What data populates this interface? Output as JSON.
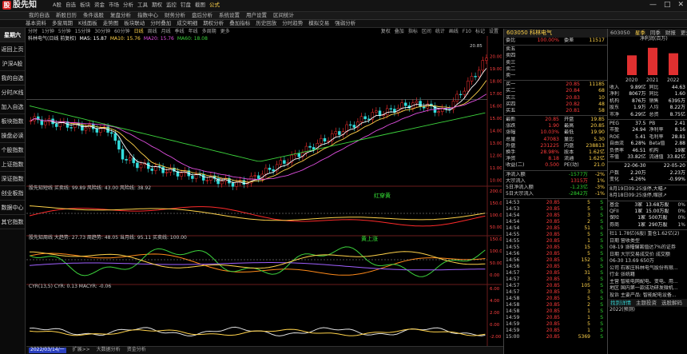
{
  "app": {
    "title": "股先知",
    "menu": [
      "A股",
      "自选",
      "板块",
      "资金",
      "市场",
      "分析",
      "工具",
      "期权",
      "监控",
      "钉盘",
      "截图"
    ],
    "menu_hl": "公式",
    "window_controls": [
      "—",
      "□",
      "✕"
    ]
  },
  "menu2": [
    "我的自选",
    "新股日历",
    "条件选股",
    "复盘分析",
    "指数中心",
    "财务分析",
    "盘后分析",
    "系统设置",
    "用户设置",
    "区间统计"
  ],
  "menu3": [
    "基本资料",
    "多窗周期",
    "K线面板",
    "走势图",
    "板块联动",
    "分时叠加",
    "成交明细",
    "期权分析",
    "叠加指标",
    "历史回放",
    "分时趋势",
    "模拟交易",
    "强弱分析"
  ],
  "sidebar": [
    {
      "label": "星期六",
      "header": true
    },
    {
      "label": "返回上页"
    },
    {
      "label": "沪深A股"
    },
    {
      "label": "我的自选"
    },
    {
      "label": "分时/K线"
    },
    {
      "label": "加入自选"
    },
    {
      "label": "板块指数"
    },
    {
      "label": "操盘必读"
    },
    {
      "label": "个股指数"
    },
    {
      "label": "上证指数"
    },
    {
      "label": "深证指数"
    },
    {
      "label": "创业板指"
    },
    {
      "label": "数据中心"
    },
    {
      "label": "其它指数"
    }
  ],
  "toolbar": {
    "items": [
      "分时",
      "1分钟",
      "5分钟",
      "15分钟",
      "30分钟",
      "60分钟",
      "日线",
      "周线",
      "月线",
      "季线",
      "年线",
      "多周期",
      "更多"
    ],
    "active": "日线",
    "right": [
      "复权",
      "叠加",
      "指标",
      "区间",
      "统计",
      "画线",
      "F10",
      "标记",
      "设置"
    ]
  },
  "main_legend": {
    "name": "科林电气(日线 前复权)",
    "items": [
      {
        "text": "MA5: 15.87",
        "color": "#ffffff"
      },
      {
        "text": "MA10: 15.76",
        "color": "#ffd24a"
      },
      {
        "text": "MA20: 15.76",
        "color": "#e04fe0"
      },
      {
        "text": "MA60: 18.08",
        "color": "#3cd23c"
      }
    ]
  },
  "price_labels": {
    "high": "20.85",
    "low": "9.68",
    "current": "16.51"
  },
  "price_axis": [
    "20.00",
    "19.00",
    "18.00",
    "17.00",
    "16.00",
    "15.00",
    "14.00",
    "13.00",
    "12.00",
    "11.00",
    "10.00"
  ],
  "panels": [
    {
      "legend": "股先知短线  买卖线: 99.89  风险线: 43.00  风险线: 38.92",
      "annotation": "红穿黄",
      "axis": [
        "200.00",
        "150.00",
        "100.00",
        "50.00"
      ]
    },
    {
      "legend": "股先知周线  大趋势: 27.73  周趋势: 48.05  当月线: 95.11  买卖线: 100.00",
      "annotation": "黄上涨",
      "axis": [
        "150.00",
        "100.00",
        "50.00",
        "0.00"
      ]
    },
    {
      "legend": "CYR(13,5)  CYR: 0.13  MACYR: -0.06",
      "annotation": "",
      "axis": [
        "6.00",
        "4.00",
        "2.00",
        "0.00",
        "-2.00"
      ]
    }
  ],
  "date_label": "2022/03/14/一",
  "bottom_tabs": [
    "扩展>>",
    "大数据分析",
    "资金分析"
  ],
  "quote": {
    "code": "603050",
    "name": "科林电气",
    "webi": "委比",
    "webi_pct": "100.00%",
    "weicha": "委差",
    "weicha_val": "11517",
    "sell": [
      {
        "l": "卖五",
        "p": "",
        "v": ""
      },
      {
        "l": "卖四",
        "p": "",
        "v": ""
      },
      {
        "l": "卖三",
        "p": "",
        "v": ""
      },
      {
        "l": "卖二",
        "p": "",
        "v": ""
      },
      {
        "l": "卖一",
        "p": "",
        "v": ""
      }
    ],
    "buy": [
      {
        "l": "买一",
        "p": "20.85",
        "v": "11185"
      },
      {
        "l": "买二",
        "p": "20.84",
        "v": "68"
      },
      {
        "l": "买三",
        "p": "20.83",
        "v": "10"
      },
      {
        "l": "买四",
        "p": "20.82",
        "v": "48"
      },
      {
        "l": "买五",
        "p": "20.81",
        "v": "58"
      }
    ],
    "stats": [
      {
        "a": "最新",
        "av": "20.85",
        "b": "开盘",
        "bv": "19.85"
      },
      {
        "a": "涨跌",
        "av": "1.90",
        "b": "最高",
        "bv": "20.85"
      },
      {
        "a": "涨幅",
        "av": "10.03%",
        "b": "最低",
        "bv": "19.90"
      },
      {
        "a": "总量",
        "av": "47083",
        "b": "量比",
        "bv": "5.30"
      },
      {
        "a": "外盘",
        "av": "231225",
        "b": "内盘",
        "bv": "238813"
      },
      {
        "a": "换手",
        "av": "28.98%",
        "b": "股本",
        "bv": "1.62亿"
      },
      {
        "a": "净资",
        "av": "8.18",
        "b": "流通",
        "bv": "1.62亿"
      },
      {
        "a": "收益(二)",
        "av": "0.500",
        "b": "PE(动)",
        "bv": "21.0"
      }
    ],
    "flow": [
      {
        "l": "净流入额",
        "v": "-1577万",
        "c": "-2%"
      },
      {
        "l": "大宗流入",
        "v": "1315万",
        "c": "1%"
      },
      {
        "l": "5日净流入额",
        "v": "-1.23亿",
        "c": "-3%"
      },
      {
        "l": "5日大宗流入",
        "v": "-2842万",
        "c": "-1%"
      }
    ],
    "ticks": [
      {
        "t": "14:53",
        "p": "20.85",
        "v": "5",
        "s": "S"
      },
      {
        "t": "14:53",
        "p": "20.85",
        "v": "5",
        "s": "S"
      },
      {
        "t": "14:54",
        "p": "20.85",
        "v": "3",
        "s": "S"
      },
      {
        "t": "14:54",
        "p": "20.85",
        "v": "2",
        "s": "S"
      },
      {
        "t": "14:54",
        "p": "20.85",
        "v": "51",
        "s": "S"
      },
      {
        "t": "14:55",
        "p": "20.85",
        "v": "5",
        "s": "S"
      },
      {
        "t": "14:55",
        "p": "20.85",
        "v": "1",
        "s": "S"
      },
      {
        "t": "14:55",
        "p": "20.85",
        "v": "15",
        "s": "S"
      },
      {
        "t": "14:56",
        "p": "20.85",
        "v": "5",
        "s": "S"
      },
      {
        "t": "14:56",
        "p": "20.85",
        "v": "152",
        "s": "S"
      },
      {
        "t": "14:56",
        "p": "20.85",
        "v": "5",
        "s": "S"
      },
      {
        "t": "14:57",
        "p": "20.85",
        "v": "31",
        "s": "S"
      },
      {
        "t": "14:57",
        "p": "20.85",
        "v": "3",
        "s": "S"
      },
      {
        "t": "14:57",
        "p": "20.85",
        "v": "105",
        "s": "S"
      },
      {
        "t": "14:57",
        "p": "20.85",
        "v": "3",
        "s": "S"
      },
      {
        "t": "14:58",
        "p": "20.85",
        "v": "5",
        "s": "S"
      },
      {
        "t": "14:58",
        "p": "20.85",
        "v": "2",
        "s": "S"
      },
      {
        "t": "14:58",
        "p": "20.85",
        "v": "1",
        "s": "S"
      },
      {
        "t": "14:59",
        "p": "20.85",
        "v": "1",
        "s": "S"
      },
      {
        "t": "14:59",
        "p": "20.85",
        "v": "5",
        "s": "S"
      },
      {
        "t": "14:59",
        "p": "20.85",
        "v": "1",
        "s": "S"
      },
      {
        "t": "15:00",
        "p": "20.85",
        "v": "5369",
        "s": "S"
      }
    ]
  },
  "farright": {
    "code": "603050",
    "tabs": [
      "星季",
      "同季",
      "财报",
      "更多"
    ],
    "tabs_active": "星季",
    "chart_title": "净利润(百万)",
    "bars": {
      "categories": [
        "2020",
        "2021",
        "2022"
      ],
      "values": [
        6.5,
        9.0,
        7.2
      ]
    },
    "finance": [
      {
        "a": "收入",
        "av": "9.89亿",
        "b": "同比",
        "bv": "44.63"
      },
      {
        "a": "净利",
        "av": "8067万",
        "b": "同比",
        "bv": "1.60"
      },
      {
        "a": "机构",
        "av": "876万",
        "b": "销售",
        "bv": "6395万"
      },
      {
        "a": "股东",
        "av": "1.9万",
        "b": "人均",
        "bv": "8.22万"
      },
      {
        "a": "市净",
        "av": "6.29亿",
        "b": "总资",
        "bv": "8.75亿"
      }
    ],
    "valuation": [
      {
        "a": "PEG",
        "av": "37.5",
        "b": "PB",
        "bv": "2.41"
      },
      {
        "a": "市盈",
        "av": "24.94",
        "b": "净利率",
        "bv": "8.16"
      },
      {
        "a": "ROE",
        "av": "5.41",
        "b": "毛利率",
        "bv": "28.81"
      },
      {
        "a": "自由流",
        "av": "6.28%",
        "b": "Beta值",
        "bv": "2.88"
      },
      {
        "a": "负债率",
        "av": "46.51",
        "b": "机构",
        "bv": "19家"
      },
      {
        "a": "市值",
        "av": "33.82亿",
        "b": "流通值",
        "bv": "33.82亿"
      }
    ],
    "periods": [
      {
        "a": "",
        "av": "22-06-30",
        "b": "",
        "bv": "22-05-20"
      },
      {
        "a": "户数",
        "av": "2.20万",
        "b": "",
        "bv": "2.23万"
      },
      {
        "a": "变化",
        "av": "-4.26%",
        "b": "",
        "bv": "-0.99%"
      }
    ],
    "news": [
      "8月19日09:25涨停,大幅↗",
      "8月18日09:25涨停,缩放↗"
    ],
    "inst": [
      {
        "a": "基金",
        "b": "3家",
        "c": "13.68万股",
        "d": "0%"
      },
      {
        "a": "QFII",
        "b": "1家",
        "c": "15.00万股",
        "d": "0%"
      },
      {
        "a": "保险",
        "b": "1家",
        "c": "500万股",
        "d": "0%"
      },
      {
        "a": "券商",
        "b": "1家",
        "c": "290万股",
        "d": "1%"
      }
    ],
    "lower": [
      "社1 1.78亿(6股)  重仓1.62亿(2)",
      "日期 营收类型",
      "08-19 涨幅偏离值达7%的证券",
      "日期 大宗交易成交价 成交额",
      "06-30 13.69 650万",
      "公司 石家庄科林电气股份有限...",
      "行业 张统籍",
      "主营 智能电网配电、变电、用...",
      "地区 国内第一款成功研发微机...",
      "投诉 主要产品: 智能配电设备..."
    ],
    "footer": [
      "找到详情",
      "主题投资",
      "选股解码"
    ],
    "year": "2022(预测)"
  }
}
